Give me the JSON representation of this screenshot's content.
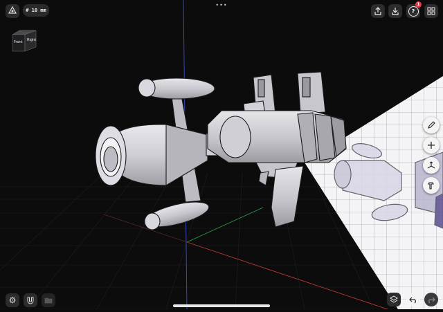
{
  "toolbar": {
    "grid_size": "# 10 mm",
    "notification_count": "1"
  },
  "view_cube": {
    "front_label": "Front",
    "right_label": "Right"
  },
  "icons": {
    "axis": "axis-gizmo-icon",
    "share": "share-icon",
    "download": "download-icon",
    "help": "help-icon",
    "grid_menu": "grid-menu-icon",
    "pencil": "pencil-icon",
    "add": "plus-icon",
    "transform": "transform-axes-icon",
    "hammer": "hammer-icon",
    "settings": "gear-icon",
    "magnet": "magnet-icon",
    "folder": "folder-icon",
    "layers": "layers-icon",
    "undo": "undo-icon",
    "redo": "redo-icon",
    "more": "more-dots-icon"
  },
  "colors": {
    "background": "#0c0c0d",
    "model_fill": "#c9c8ce",
    "badge": "#e0394a",
    "axis_y": "#3a4fd0",
    "axis_x": "#c0392b",
    "axis_z": "#2e9e4e"
  }
}
